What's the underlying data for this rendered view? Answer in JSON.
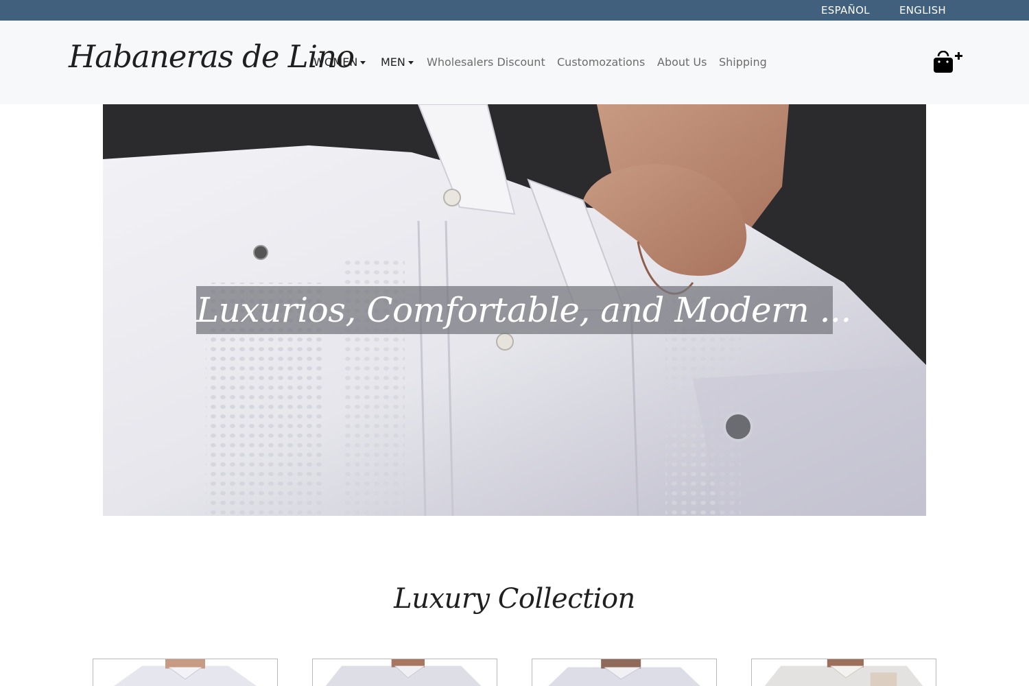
{
  "languages": {
    "spanish": "ESPAÑOL",
    "english": "ENGLISH"
  },
  "brand": {
    "name": "Habaneras de Lino"
  },
  "nav": {
    "women": "WOMEN",
    "men": "MEN",
    "wholesalers": "Wholesalers Discount",
    "customizations": "Customozations",
    "about": "About Us",
    "shipping": "Shipping"
  },
  "cart": {
    "icon": "shopping-bag-plus-icon"
  },
  "hero": {
    "caption": "Luxurios, Comfortable, and Modern ..."
  },
  "collection": {
    "title": "Luxury Collection",
    "products": [
      {
        "image": "white-guayabera-front"
      },
      {
        "image": "white-guayabera-embroidered"
      },
      {
        "image": "white-guayabera-pleated"
      },
      {
        "image": "white-guayabera-beige-accent"
      }
    ]
  },
  "colors": {
    "top_bar": "#41607d",
    "nav_bg": "#f7f8fa",
    "accent_dark": "#1f1f1f"
  }
}
